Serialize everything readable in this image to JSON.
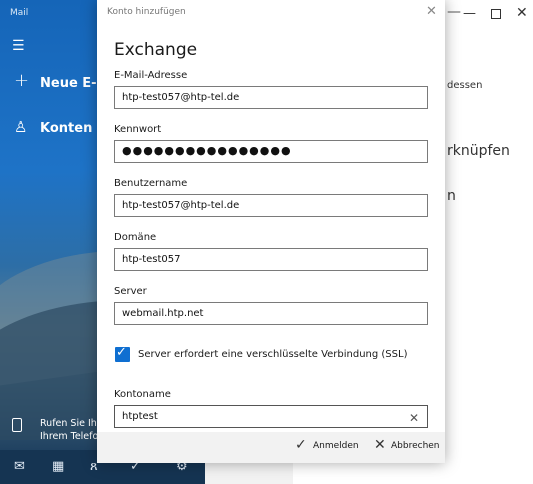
{
  "sidebar": {
    "app_title": "Mail",
    "new_mail_label": "Neue E-M",
    "accounts_label": "Konten",
    "call_text_1": "Rufen Sie Ihr",
    "call_text_2": "Ihrem Telefo"
  },
  "background": {
    "text_1": "dessen",
    "text_2": "rknüpfen",
    "text_3": "n"
  },
  "dialog": {
    "header": "Konto hinzufügen",
    "title": "Exchange",
    "email": {
      "label": "E-Mail-Adresse",
      "value": "htp-test057@htp-tel.de"
    },
    "password": {
      "label": "Kennwort",
      "value": "●●●●●●●●●●●●●●●●"
    },
    "username": {
      "label": "Benutzername",
      "value": "htp-test057@htp-tel.de"
    },
    "domain": {
      "label": "Domäne",
      "value": "htp-test057"
    },
    "server": {
      "label": "Server",
      "value": "webmail.htp.net"
    },
    "ssl": {
      "label": "Server erfordert eine verschlüsselte Verbindung (SSL)",
      "checked": true
    },
    "account_name": {
      "label": "Kontoname",
      "value": "htptest"
    },
    "signin_label": "Anmelden",
    "cancel_label": "Abbrechen"
  },
  "colors": {
    "accent": "#0f6fd1",
    "sidebar": "#1e73c7"
  },
  "icons": [
    "hamburger-icon",
    "plus-icon",
    "person-icon",
    "phone-icon",
    "mail-icon",
    "calendar-icon",
    "people-icon",
    "todo-icon",
    "settings-icon",
    "close-icon",
    "check-icon"
  ]
}
